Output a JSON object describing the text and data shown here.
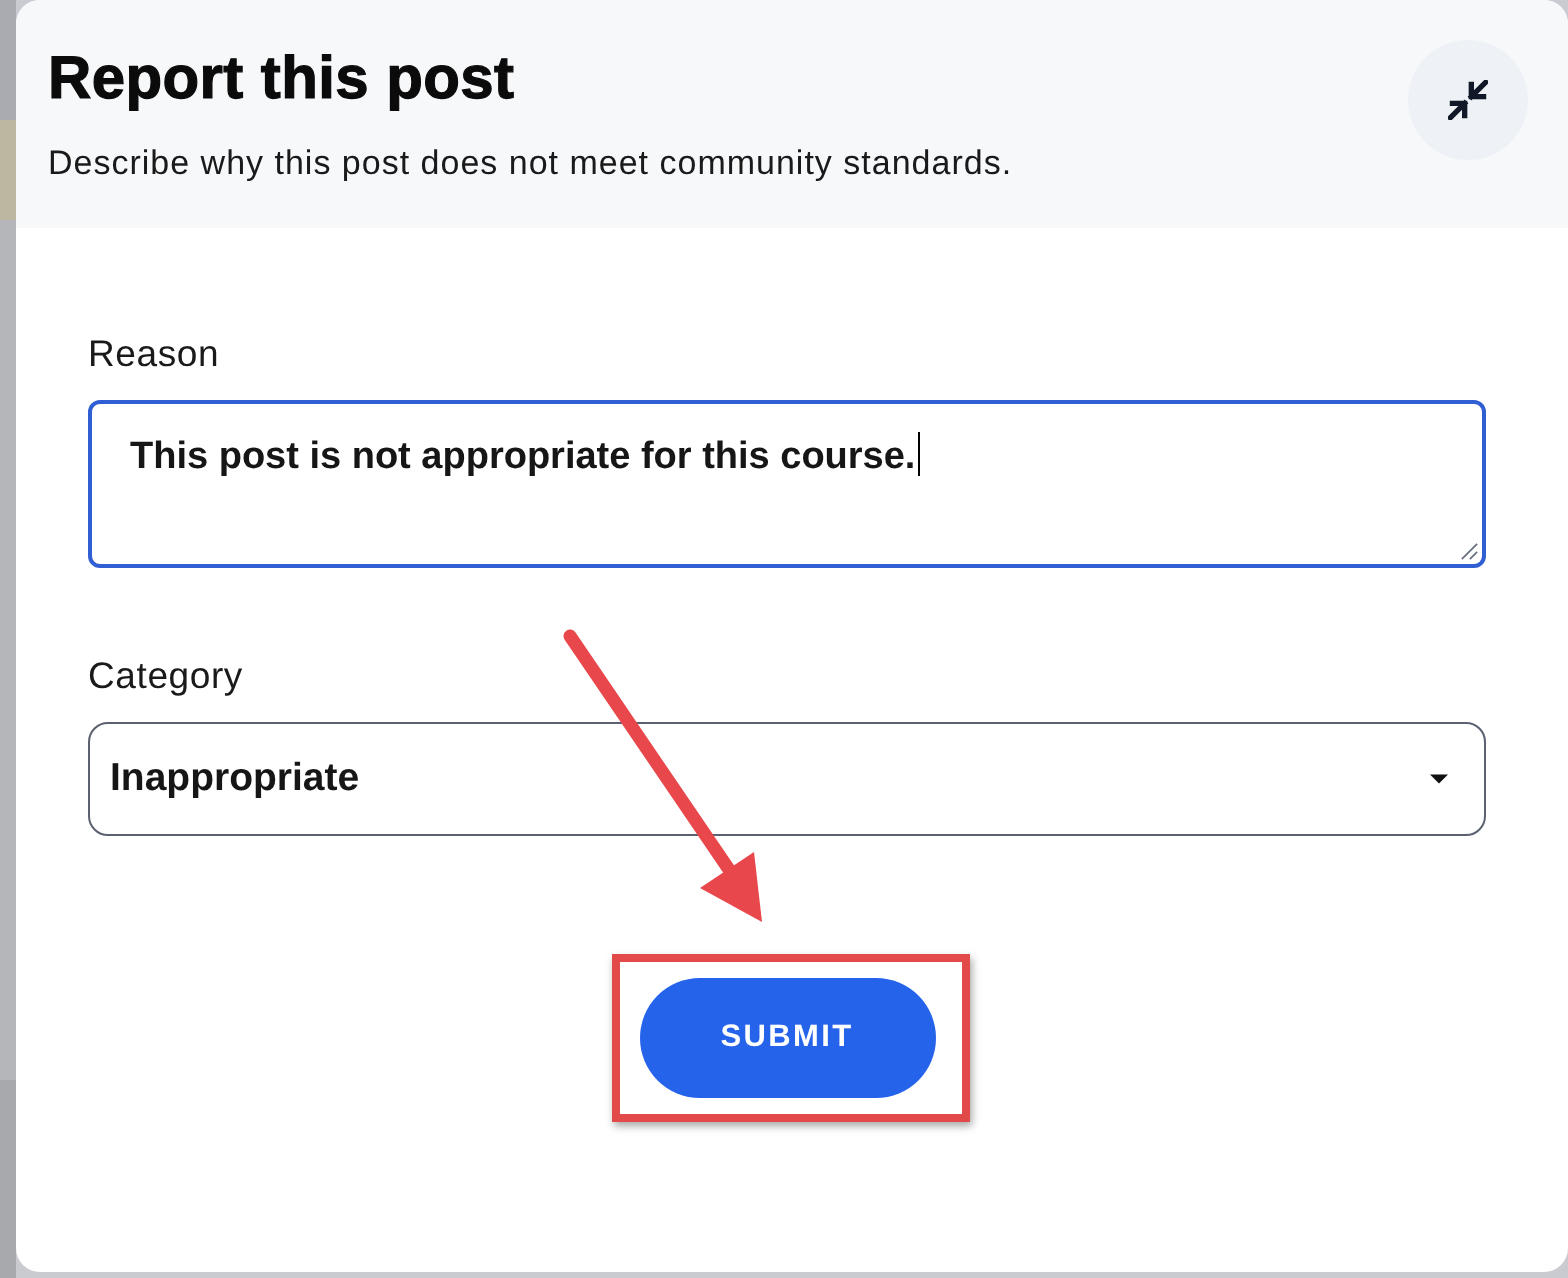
{
  "dialog": {
    "title": "Report this post",
    "subtitle": "Describe why this post does not meet community standards.",
    "fields": [
      {
        "kind": "textarea",
        "label": "Reason",
        "value": "This post is not appropriate for this course.",
        "focused": true
      },
      {
        "kind": "select",
        "label": "Category",
        "value": "Inappropriate",
        "focused": false
      }
    ],
    "submit_button": {
      "label": "SUBMIT"
    }
  },
  "annotations": {
    "arrow": true,
    "highlight_frame": true
  }
}
